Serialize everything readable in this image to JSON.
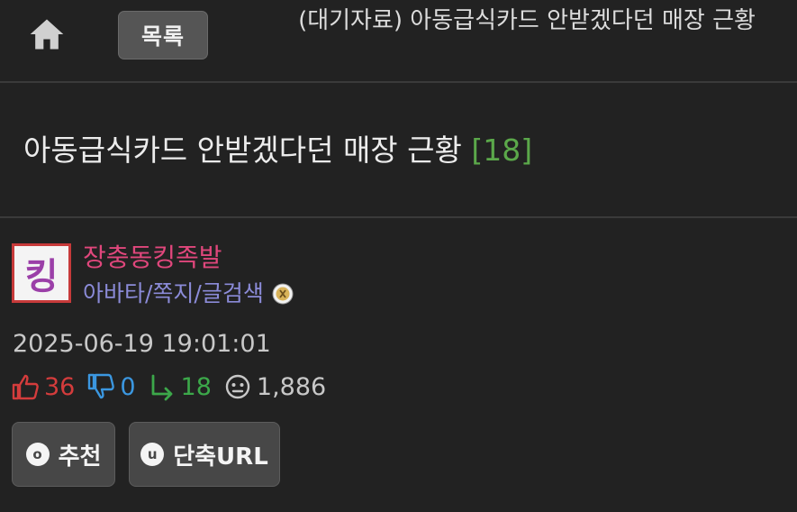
{
  "header": {
    "home_icon": "home-icon",
    "list_button": "목록",
    "title": "(대기자료) 아동급식카드 안받겠다던 매장 근황"
  },
  "post": {
    "title": "아동급식카드 안받겠다던 매장 근황",
    "comment_count": "[18]"
  },
  "author": {
    "avatar_text": "킹",
    "nickname": "장충동킹족발",
    "links": "아바타/쪽지/글검색",
    "level_icon": "level-badge-icon"
  },
  "meta": {
    "date": "2025-06-19 19:01:01",
    "upvotes": "36",
    "downvotes": "0",
    "replies": "18",
    "views": "1,886"
  },
  "actions": {
    "recommend_icon_glyph": "o",
    "recommend_label": "추천",
    "shorturl_icon_glyph": "u",
    "shorturl_label": "단축URL"
  },
  "colors": {
    "background": "#222222",
    "comment_count": "#5ba84a",
    "nickname": "#e0477c",
    "links": "#8b8bd8",
    "upvote": "#d43c3c",
    "downvote": "#3b97e0",
    "reply": "#3ca84a"
  }
}
